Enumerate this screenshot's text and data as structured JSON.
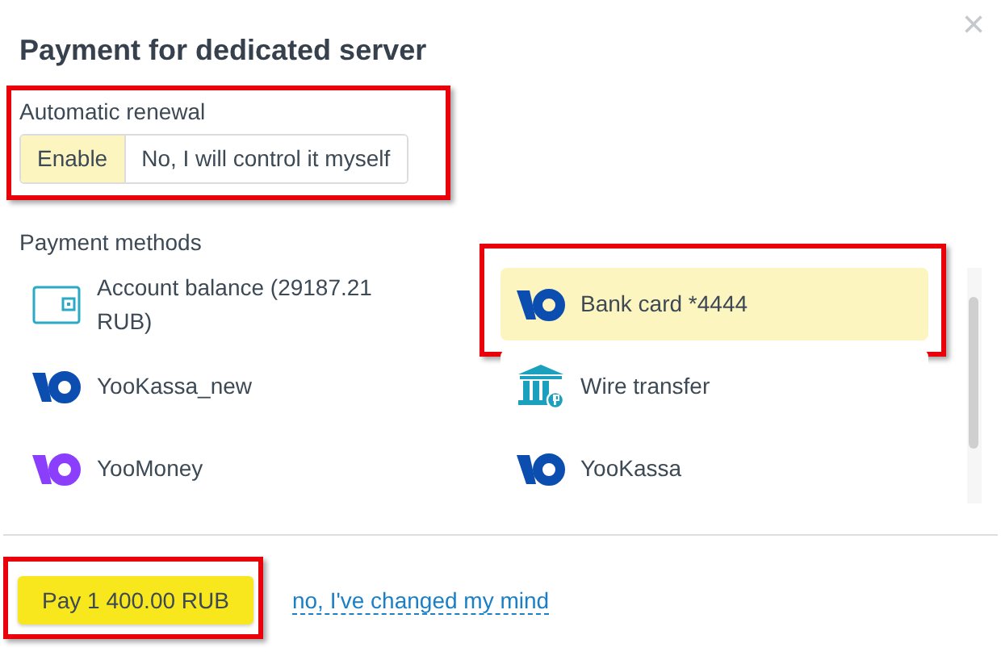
{
  "dialog": {
    "title": "Payment for dedicated server",
    "close": "×"
  },
  "renewal": {
    "label": "Automatic renewal",
    "highlighted": true,
    "options": [
      {
        "label": "Enable",
        "selected": true
      },
      {
        "label": "No, I will control it myself",
        "selected": false
      }
    ]
  },
  "payment_methods": {
    "label": "Payment methods",
    "items": [
      {
        "name": "Account balance (29187.21 RUB)",
        "kind": "wallet",
        "selected": false,
        "highlighted": false
      },
      {
        "name": "Bank card *4444",
        "kind": "yookassa",
        "selected": true,
        "highlighted": true
      },
      {
        "name": "YooKassa_new",
        "kind": "yookassa",
        "selected": false,
        "highlighted": false
      },
      {
        "name": "Wire transfer",
        "kind": "bank",
        "selected": false,
        "highlighted": false
      },
      {
        "name": "YooMoney",
        "kind": "yoomoney",
        "selected": false,
        "highlighted": false
      },
      {
        "name": "YooKassa",
        "kind": "yookassa",
        "selected": false,
        "highlighted": false
      }
    ]
  },
  "footer": {
    "pay_button": {
      "label": "Pay 1 400.00 RUB",
      "highlighted": true
    },
    "cancel_link": "no, I've changed my mind"
  }
}
